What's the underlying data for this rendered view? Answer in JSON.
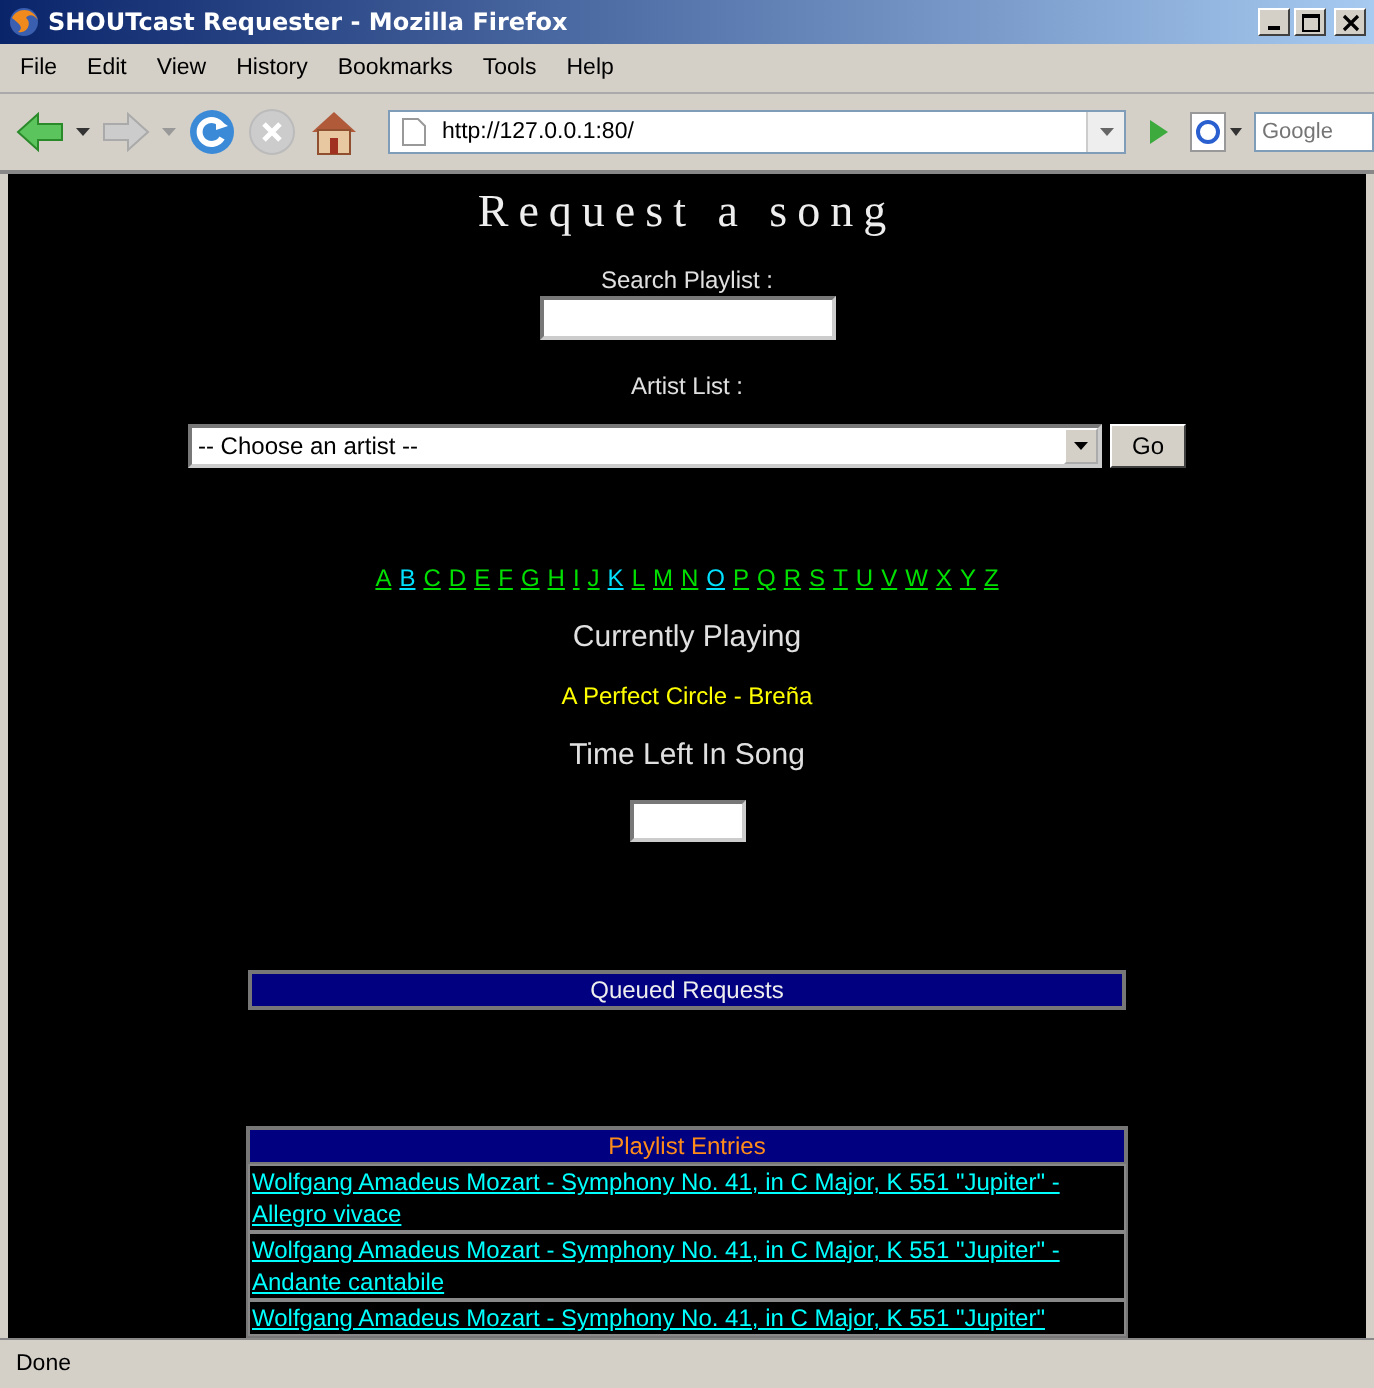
{
  "window": {
    "title": "SHOUTcast Requester - Mozilla Firefox"
  },
  "menu": [
    "File",
    "Edit",
    "View",
    "History",
    "Bookmarks",
    "Tools",
    "Help"
  ],
  "toolbar": {
    "url": "http://127.0.0.1:80/",
    "search_placeholder": "Google"
  },
  "page": {
    "heading": "Request a song",
    "search_label": "Search Playlist :",
    "artist_label": "Artist List :",
    "artist_select": "-- Choose an artist --",
    "go_button": "Go",
    "letters": [
      {
        "label": "A",
        "visited": false
      },
      {
        "label": "B",
        "visited": true
      },
      {
        "label": "C",
        "visited": false
      },
      {
        "label": "D",
        "visited": false
      },
      {
        "label": "E",
        "visited": false
      },
      {
        "label": "F",
        "visited": false
      },
      {
        "label": "G",
        "visited": false
      },
      {
        "label": "H",
        "visited": false
      },
      {
        "label": "I",
        "visited": false
      },
      {
        "label": "J",
        "visited": false
      },
      {
        "label": "K",
        "visited": true
      },
      {
        "label": "L",
        "visited": false
      },
      {
        "label": "M",
        "visited": false
      },
      {
        "label": "N",
        "visited": false
      },
      {
        "label": "O",
        "visited": true
      },
      {
        "label": "P",
        "visited": false
      },
      {
        "label": "Q",
        "visited": false
      },
      {
        "label": "R",
        "visited": false
      },
      {
        "label": "S",
        "visited": false
      },
      {
        "label": "T",
        "visited": false
      },
      {
        "label": "U",
        "visited": false
      },
      {
        "label": "V",
        "visited": false
      },
      {
        "label": "W",
        "visited": false
      },
      {
        "label": "X",
        "visited": false
      },
      {
        "label": "Y",
        "visited": false
      },
      {
        "label": "Z",
        "visited": false
      }
    ],
    "now_playing_heading": "Currently Playing",
    "now_playing": "A Perfect Circle - Breña",
    "time_left_heading": "Time Left In Song",
    "queue_heading": "Queued Requests",
    "playlist_heading": "Playlist Entries",
    "playlist": [
      {
        "title": "Wolfgang Amadeus Mozart - Symphony No. 41, in C Major, K 551 \"Jupiter\" - Allegro vivace"
      },
      {
        "title": "Wolfgang Amadeus Mozart - Symphony No. 41, in C Major, K 551 \"Jupiter\" - Andante cantabile"
      },
      {
        "title": "Wolfgang Amadeus Mozart - Symphony No. 41, in C Major, K 551 \"Jupiter\""
      }
    ]
  },
  "status_bar": "Done"
}
